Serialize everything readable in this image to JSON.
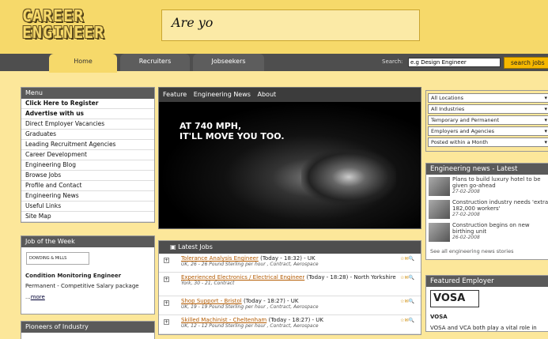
{
  "header": {
    "logo_line1": "CAREER",
    "logo_line2": "ENGINEER",
    "banner_text": "Are yo"
  },
  "nav": {
    "tabs": [
      "Home",
      "Recruiters",
      "Jobseekers"
    ],
    "search_label": "Search:",
    "search_value": "e.g Design Engineer",
    "search_button": "search jobs"
  },
  "menu": {
    "title": "Menu",
    "items": [
      "Click Here to Register",
      "Advertise with us",
      "Direct Employer Vacancies",
      "Graduates",
      "Leading Recruitment Agencies",
      "Career Development",
      "Engineering Blog",
      "Browse Jobs",
      "Profile and Contact",
      "Engineering News",
      "Useful Links",
      "Site Map"
    ]
  },
  "job_of_week": {
    "title": "Job of the Week",
    "logo_text": "DOWDING & MILLS",
    "job_title": "Condition Monitoring Engineer",
    "job_desc": "Permanent - Competitive Salary package",
    "more_prefix": "...",
    "more": "more"
  },
  "pioneers": {
    "title": "Pioneers of Industry"
  },
  "feature": {
    "tabs": [
      "Feature",
      "Engineering News",
      "About"
    ],
    "ad_line1": "AT 740 MPH,",
    "ad_line2": "IT'LL MOVE YOU TOO."
  },
  "latest_jobs": {
    "title": "Latest Jobs",
    "jobs": [
      {
        "title": "Tolerance Analysis Engineer",
        "meta": "(Today - 18:32) - UK",
        "detail": "UK, 26 - 26 Pound Sterling per hour , Contract, Aerospace"
      },
      {
        "title": "Experienced Electronics / Electrical Engineer",
        "meta": "(Today - 18:28) - North Yorkshire",
        "detail": "York, 30 - 21, Contract"
      },
      {
        "title": "Shop Support - Bristol",
        "meta": "(Today - 18:27) - UK",
        "detail": "UK, 19 - 19 Pound Sterling per hour , Contract, Aerospace"
      },
      {
        "title": "Skilled Machinist - Cheltenham",
        "meta": "(Today - 18:27) - UK",
        "detail": "UK, 12 - 12 Pound Sterling per hour , Contract, Aerospace"
      }
    ]
  },
  "filters": {
    "options": [
      "All Locations",
      "All Industries",
      "Temporary and Permanent",
      "Employers and Agencies",
      "Posted within a Month"
    ]
  },
  "news": {
    "title": "Engineering news - Latest",
    "items": [
      {
        "title": "Plans to build luxury hotel to be given go-ahead",
        "date": "27-02-2008"
      },
      {
        "title": "Construction industry needs 'extra 182,000 workers'",
        "date": "27-02-2008"
      },
      {
        "title": "Construction begins on new birthing unit",
        "date": "26-02-2008"
      }
    ],
    "see_all": "See all engineering news stories"
  },
  "featured": {
    "title": "Featured Employer",
    "logo": "VOSA",
    "name": "VOSA",
    "desc": "VOSA and VCA both play a vital role in"
  }
}
